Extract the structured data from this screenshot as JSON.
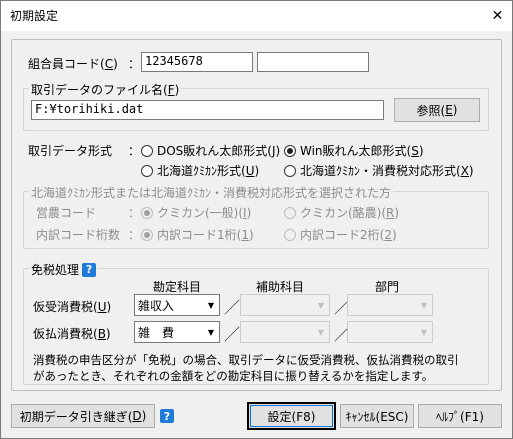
{
  "window": {
    "title": "初期設定",
    "close_glyph": "✕"
  },
  "union_code": {
    "label": "組合員コード(",
    "key": "C",
    "label_end": ")",
    "colon": "：",
    "value": "12345678",
    "value2": ""
  },
  "file_group": {
    "legend": "取引データのファイル名(",
    "key": "F",
    "legend_end": ")",
    "path": "F:¥torihiki.dat",
    "browse_label": "参照(",
    "browse_key": "E",
    "browse_end": ")"
  },
  "format": {
    "label": "取引データ形式",
    "colon": "：",
    "options": [
      {
        "label": "DOS販れん太郎形式(",
        "key": "J",
        "end": ")",
        "checked": false
      },
      {
        "label": "Win販れん太郎形式(",
        "key": "S",
        "end": ")",
        "checked": true
      },
      {
        "label": "北海道ｸﾐｶﾝ形式(",
        "key": "U",
        "end": ")",
        "checked": false
      },
      {
        "label": "北海道ｸﾐｶﾝ・消費税対応形式(",
        "key": "X",
        "end": ")",
        "checked": false
      }
    ]
  },
  "hokkaido": {
    "legend": "北海道ｸﾐｶﾝ形式または北海道ｸﾐｶﾝ・消費税対応形式を選択された方",
    "farm_label": "営農コード",
    "colon": "：",
    "farm_opt1": "クミカン(一般)(",
    "farm_opt1_key": "I",
    "farm_opt2": "クミカン(酪農)(",
    "farm_opt2_key": "R",
    "digits_label": "内訳コード桁数",
    "digits_opt1": "内訳コード1桁(",
    "digits_opt1_key": "1",
    "digits_opt2": "内訳コード2桁(",
    "digits_opt2_key": "2",
    "close_paren": ")"
  },
  "tax": {
    "legend": "免税処理",
    "help_glyph": "?",
    "col_account": "勘定科目",
    "col_sub": "補助科目",
    "col_dept": "部門",
    "row1_label": "仮受消費税(",
    "row1_key": "U",
    "row1_end": ")",
    "row1_value": "雑収入",
    "row2_label": "仮払消費税(",
    "row2_key": "B",
    "row2_end": ")",
    "row2_value": "雑　費",
    "separator": "／",
    "note_line1": "消費税の申告区分が「免税」の場合、取引データに仮受消費税、仮払消費税の取引",
    "note_line2": "があったとき、それぞれの金額をどの勘定科目に振り替えるかを指定します。"
  },
  "footer": {
    "carry_label": "初期データ引き継ぎ(",
    "carry_key": "D",
    "carry_end": ")",
    "help_glyph": "?",
    "ok_label": "設定(F8)",
    "cancel_label": "ｷｬﾝｾﾙ(ESC)",
    "help_label": "ﾍﾙﾌﾟ(F1)"
  }
}
